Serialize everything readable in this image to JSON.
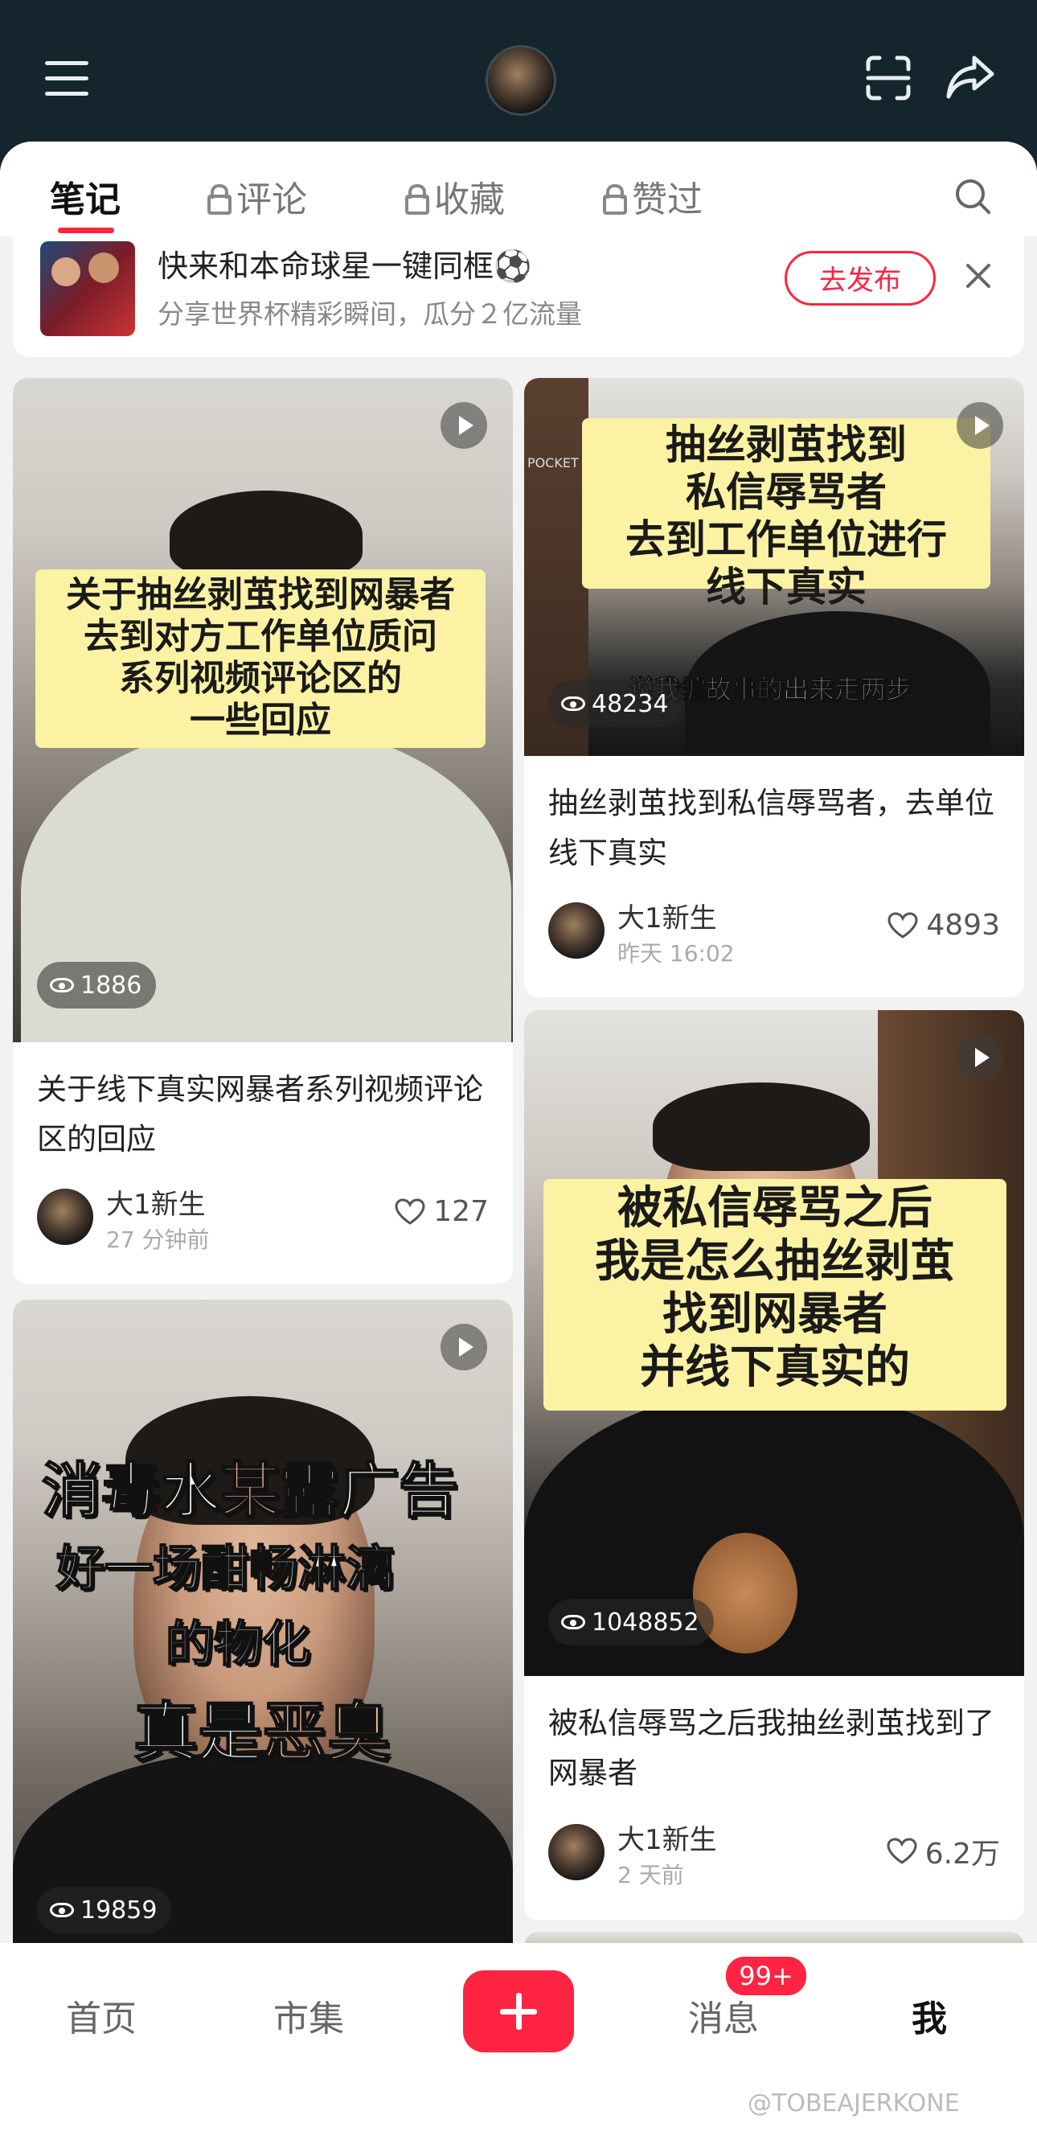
{
  "header": {
    "avatar_icon": "profile-avatar",
    "scan_icon": "scan-icon",
    "share_icon": "share-icon"
  },
  "tabs": [
    {
      "label": "笔记",
      "active": true,
      "locked": false
    },
    {
      "label": "评论",
      "locked": true
    },
    {
      "label": "收藏",
      "locked": true
    },
    {
      "label": "赞过",
      "locked": true
    }
  ],
  "banner": {
    "title": "快来和本命球星一键同框⚽",
    "subtitle": "分享世界杯精彩瞬间，瓜分２亿流量",
    "button": "去发布"
  },
  "cards": [
    {
      "caption": "关于抽丝剥茧找到网暴者\n去到对方工作单位质问\n系列视频评论区的\n一些回应",
      "views": "1886",
      "title": "关于线下真实网暴者系列视频评论区的回应",
      "author": "大1新生",
      "time": "27 分钟前",
      "likes": "127"
    },
    {
      "caption": "抽丝剥茧找到\n私信辱骂者\n去到工作单位进行\n线下真实",
      "subtitle_overlay": "说我编故事的出来走两步",
      "corner_text": "POCKET",
      "views": "48234",
      "title": "抽丝剥茧找到私信辱骂者，去单位线下真实",
      "author": "大1新生",
      "time": "昨天 16:02",
      "likes": "4893"
    },
    {
      "caption": "被私信辱骂之后\n我是怎么抽丝剥茧\n找到网暴者\n并线下真实的",
      "views": "1048852",
      "title": "被私信辱骂之后我抽丝剥茧找到了网暴者",
      "author": "大1新生",
      "time": "2 天前",
      "likes": "6.2万"
    },
    {
      "overlay_line1a": "消毒水",
      "overlay_line1b": "某露",
      "overlay_line1c": "广告",
      "overlay_line2": "好一场酣畅淋漓",
      "overlay_line3": "的物化",
      "overlay_line4a": "真是",
      "overlay_line4b": "恶臭",
      "views": "19859"
    }
  ],
  "bottom_nav": {
    "home": "首页",
    "market": "市集",
    "messages": "消息",
    "badge": "99+",
    "me": "我"
  },
  "watermark": "@TOBEAJERKONE",
  "colors": {
    "accent": "#ff2442",
    "header_bg": "#14252e",
    "caption_bg": "#fbf2a3"
  }
}
